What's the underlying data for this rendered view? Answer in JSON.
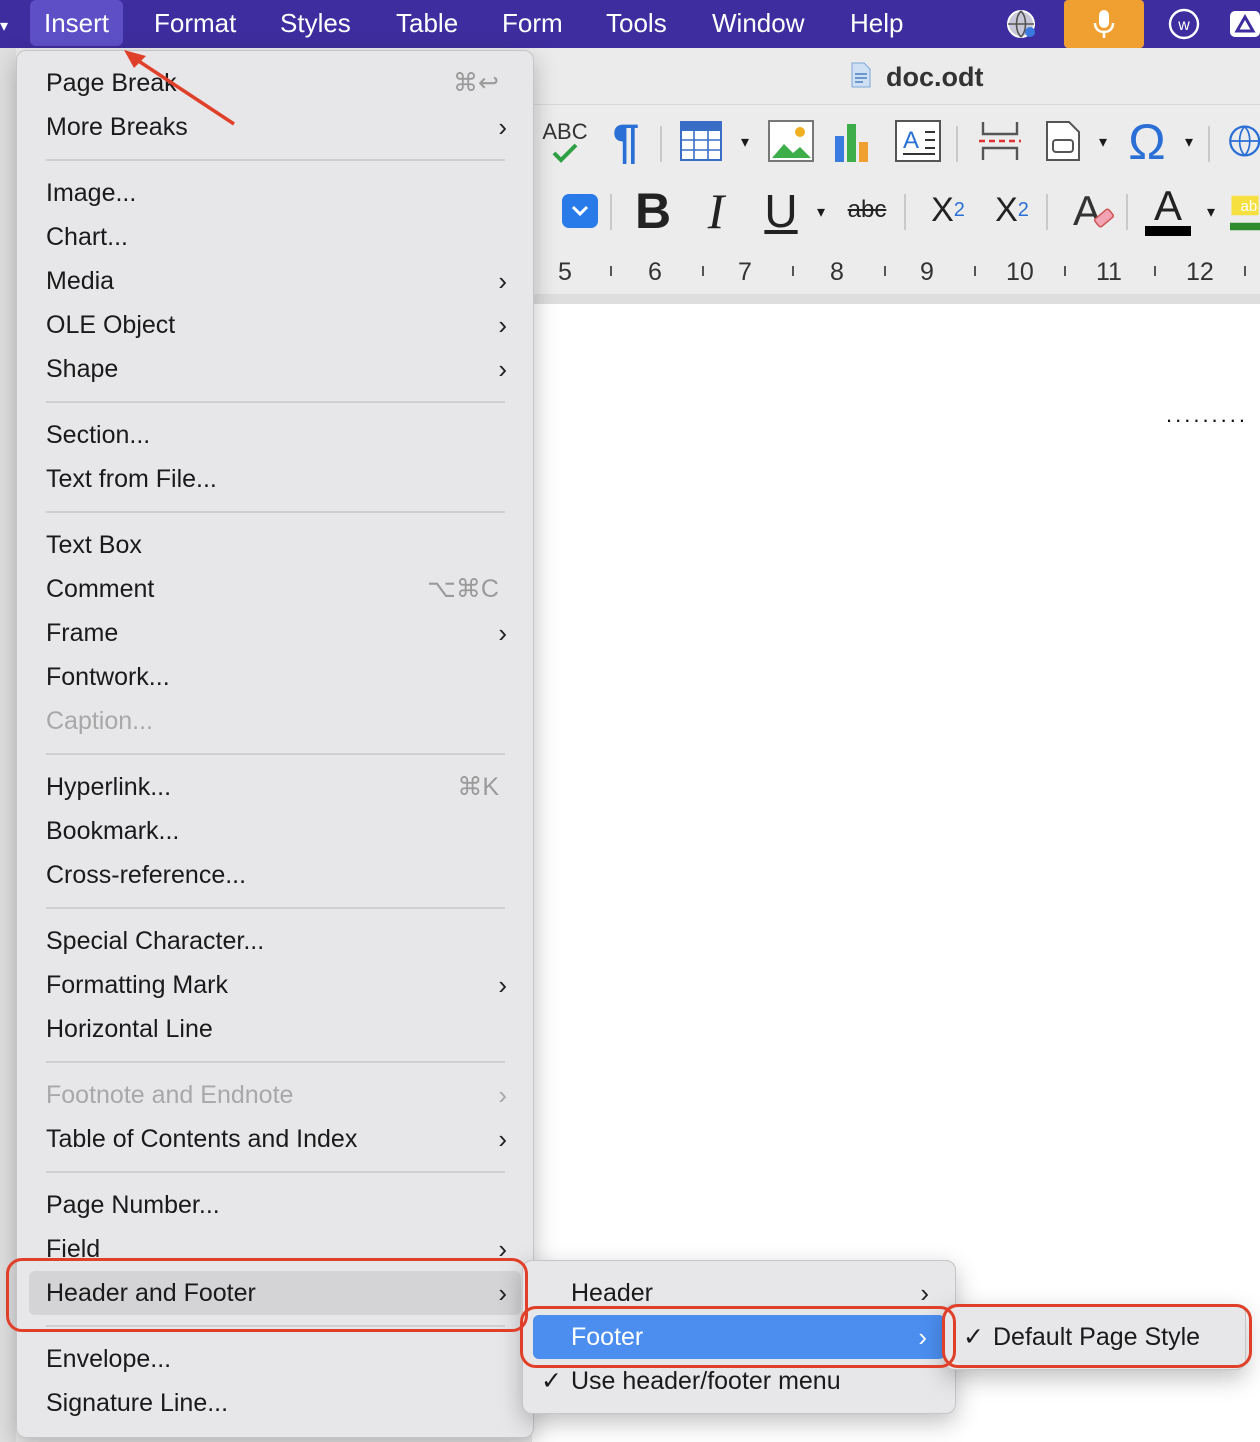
{
  "menubar": {
    "items": [
      "Insert",
      "Format",
      "Styles",
      "Table",
      "Form",
      "Tools",
      "Window",
      "Help"
    ],
    "active": "Insert"
  },
  "document": {
    "title": "doc.odt"
  },
  "toolbar": {
    "spelling_label": "ABC",
    "bold": "B",
    "italic": "I",
    "underline": "U",
    "strike": "abc",
    "superscript_base": "X",
    "superscript_exp": "2",
    "subscript_base": "X",
    "subscript_sub": "2",
    "special_char": "Ω",
    "highlight_label": "ab"
  },
  "ruler": {
    "numbers": [
      "5",
      "6",
      "7",
      "8",
      "9",
      "10",
      "11",
      "12"
    ]
  },
  "insert_menu": {
    "items": [
      {
        "label": "Page Break",
        "shortcut": "⌘↩"
      },
      {
        "label": "More Breaks",
        "submenu": true
      },
      {
        "label": "Image..."
      },
      {
        "label": "Chart..."
      },
      {
        "label": "Media",
        "submenu": true
      },
      {
        "label": "OLE Object",
        "submenu": true
      },
      {
        "label": "Shape",
        "submenu": true
      },
      {
        "label": "Section..."
      },
      {
        "label": "Text from File..."
      },
      {
        "label": "Text Box"
      },
      {
        "label": "Comment",
        "shortcut": "⌥⌘C"
      },
      {
        "label": "Frame",
        "submenu": true
      },
      {
        "label": "Fontwork..."
      },
      {
        "label": "Caption...",
        "disabled": true
      },
      {
        "label": "Hyperlink...",
        "shortcut": "⌘K"
      },
      {
        "label": "Bookmark..."
      },
      {
        "label": "Cross-reference..."
      },
      {
        "label": "Special Character..."
      },
      {
        "label": "Formatting Mark",
        "submenu": true
      },
      {
        "label": "Horizontal Line"
      },
      {
        "label": "Footnote and Endnote",
        "submenu": true,
        "disabled": true
      },
      {
        "label": "Table of Contents and Index",
        "submenu": true
      },
      {
        "label": "Page Number..."
      },
      {
        "label": "Field",
        "submenu": true
      },
      {
        "label": "Header and Footer",
        "submenu": true,
        "highlighted": true
      },
      {
        "label": "Envelope..."
      },
      {
        "label": "Signature Line..."
      }
    ]
  },
  "header_footer_menu": {
    "items": [
      {
        "label": "Header",
        "submenu": true
      },
      {
        "label": "Footer",
        "submenu": true,
        "selected": true
      },
      {
        "label": "Use header/footer menu",
        "checked": true
      }
    ]
  },
  "footer_menu": {
    "items": [
      {
        "label": "Default Page Style",
        "checked": true
      }
    ]
  },
  "colors": {
    "menubar": "#3e2d9e",
    "selection": "#4b8ef0",
    "annotation": "#e0402a",
    "mic_button": "#f0a030"
  }
}
